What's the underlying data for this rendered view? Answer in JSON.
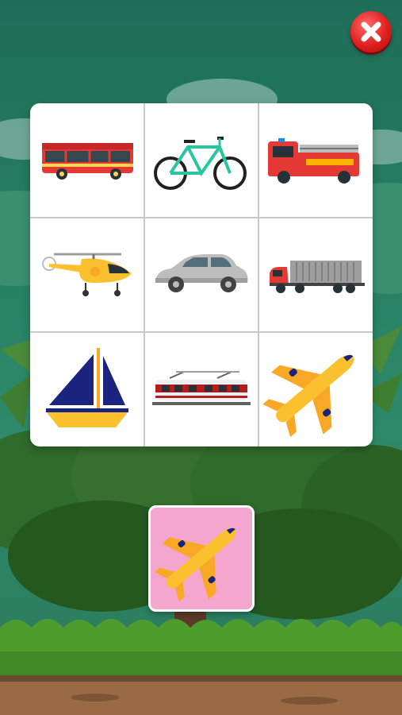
{
  "game": {
    "screen": "vehicle-matching",
    "grid": [
      {
        "row": 1,
        "items": [
          "bus",
          "bicycle",
          "fire-truck"
        ]
      },
      {
        "row": 2,
        "items": [
          "helicopter",
          "car",
          "cargo-truck"
        ]
      },
      {
        "row": 3,
        "items": [
          "sailboat",
          "train",
          "airplane"
        ]
      }
    ],
    "target_item": "airplane",
    "target_background": "#f4a6cf"
  },
  "colors": {
    "sky": "#2a7a62",
    "grass": "#3f8a2a",
    "ground": "#9a6a45",
    "close_button": "#e01f1f"
  },
  "icons": {
    "close": "close-icon"
  }
}
